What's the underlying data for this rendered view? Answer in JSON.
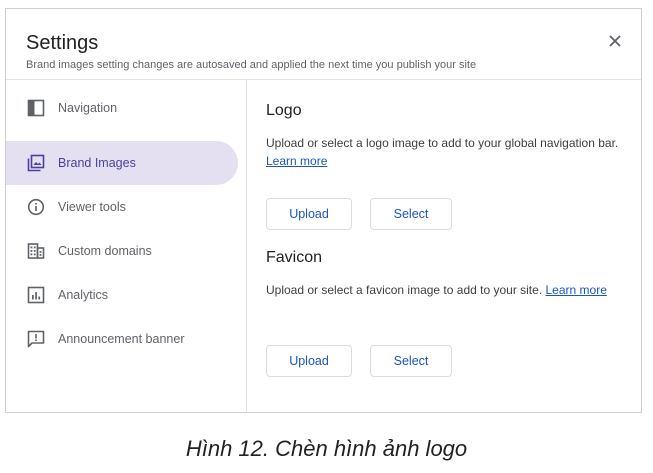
{
  "dialog": {
    "title": "Settings",
    "subtitle": "Brand images setting changes are autosaved and applied the next time you publish your site"
  },
  "sidebar": {
    "items": [
      {
        "label": "Navigation",
        "icon": "navigation-panel-icon",
        "active": false
      },
      {
        "label": "Brand Images",
        "icon": "image-gallery-icon",
        "active": true
      },
      {
        "label": "Viewer tools",
        "icon": "info-circle-icon",
        "active": false
      },
      {
        "label": "Custom domains",
        "icon": "building-icon",
        "active": false
      },
      {
        "label": "Analytics",
        "icon": "bar-chart-icon",
        "active": false
      },
      {
        "label": "Announcement banner",
        "icon": "announcement-icon",
        "active": false
      }
    ]
  },
  "logo": {
    "title": "Logo",
    "description": "Upload or select a logo image to add to your global navigation bar.",
    "link": "Learn more",
    "upload_label": "Upload",
    "select_label": "Select"
  },
  "favicon": {
    "title": "Favicon",
    "description": "Upload or select a favicon image to add to your site.",
    "link": "Learn more",
    "upload_label": "Upload",
    "select_label": "Select"
  },
  "colors": {
    "active_bg": "#e4e0f2",
    "accent": "#4b3f9e",
    "link": "#1a55c4"
  },
  "caption": "Hình 12. Chèn hình ảnh logo"
}
